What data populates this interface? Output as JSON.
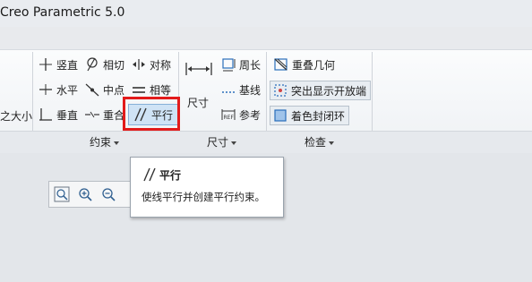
{
  "window": {
    "title": "Creo Parametric 5.0"
  },
  "constrain": {
    "vertical": "竖直",
    "horizontal": "水平",
    "perpendicular": "垂直",
    "tangent": "相切",
    "midpoint": "中点",
    "coincident": "重合",
    "symmetric": "对称",
    "equal": "相等",
    "parallel": "平行",
    "group_label": "约束"
  },
  "left_clip": {
    "label": "之大小"
  },
  "dimension": {
    "main": "尺寸",
    "perimeter": "周长",
    "baseline": "基线",
    "reference": "参考",
    "group_label": "尺寸"
  },
  "inspect": {
    "overlap": "重叠几何",
    "highlight_open": "突出显示开放端",
    "shade_closed": "着色封闭环",
    "group_label": "检查"
  },
  "tooltip": {
    "title": "平行",
    "description": "使线平行并创建平行约束。"
  }
}
